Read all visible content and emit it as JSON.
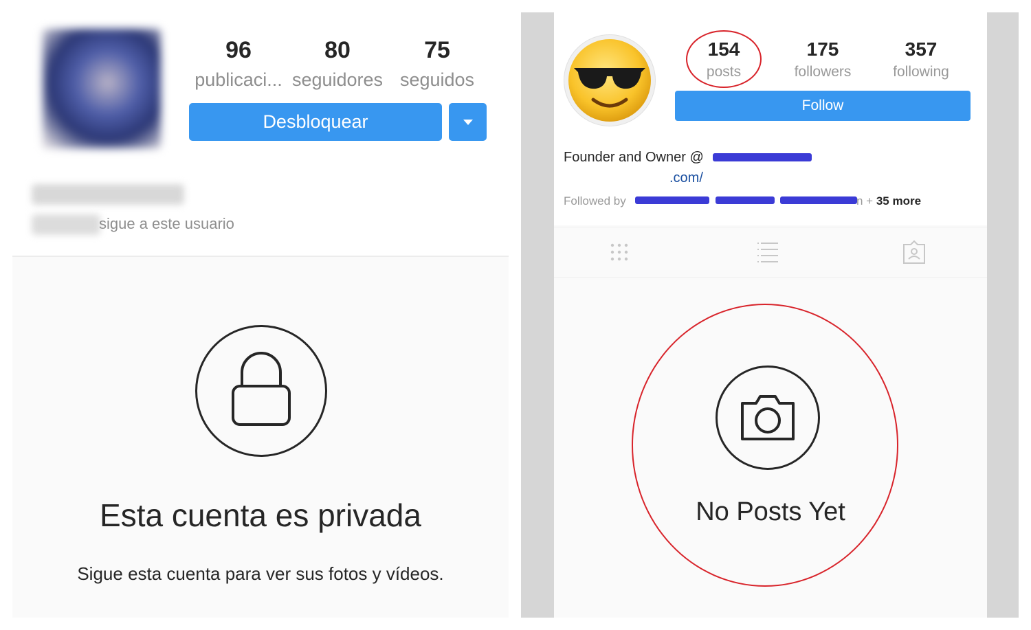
{
  "left_profile": {
    "stats": [
      {
        "value": "96",
        "label": "publicaci..."
      },
      {
        "value": "80",
        "label": "seguidores"
      },
      {
        "value": "75",
        "label": "seguidos"
      }
    ],
    "unblock_label": "Desbloquear",
    "followed_by_text": "sigue a este usuario",
    "private_title": "Esta cuenta es privada",
    "private_subtitle": "Sigue esta cuenta para ver sus fotos y vídeos."
  },
  "right_profile": {
    "stats": [
      {
        "value": "154",
        "label": "posts"
      },
      {
        "value": "175",
        "label": "followers"
      },
      {
        "value": "357",
        "label": "following"
      }
    ],
    "follow_label": "Follow",
    "bio_line1": "Founder and Owner @",
    "bio_line2": ".com/",
    "followed_by_prefix": "Followed by",
    "followed_by_more_plus": "n +",
    "followed_by_more": "35 more",
    "empty_state": "No Posts Yet"
  },
  "colors": {
    "button_blue": "#3897f0",
    "highlight_red": "#d8232a",
    "redaction_blue": "#3b3bd6"
  },
  "icons": [
    "lock-icon",
    "chevron-down-icon",
    "grid-icon",
    "list-icon",
    "tagged-icon",
    "camera-icon",
    "sunglasses-emoji"
  ]
}
